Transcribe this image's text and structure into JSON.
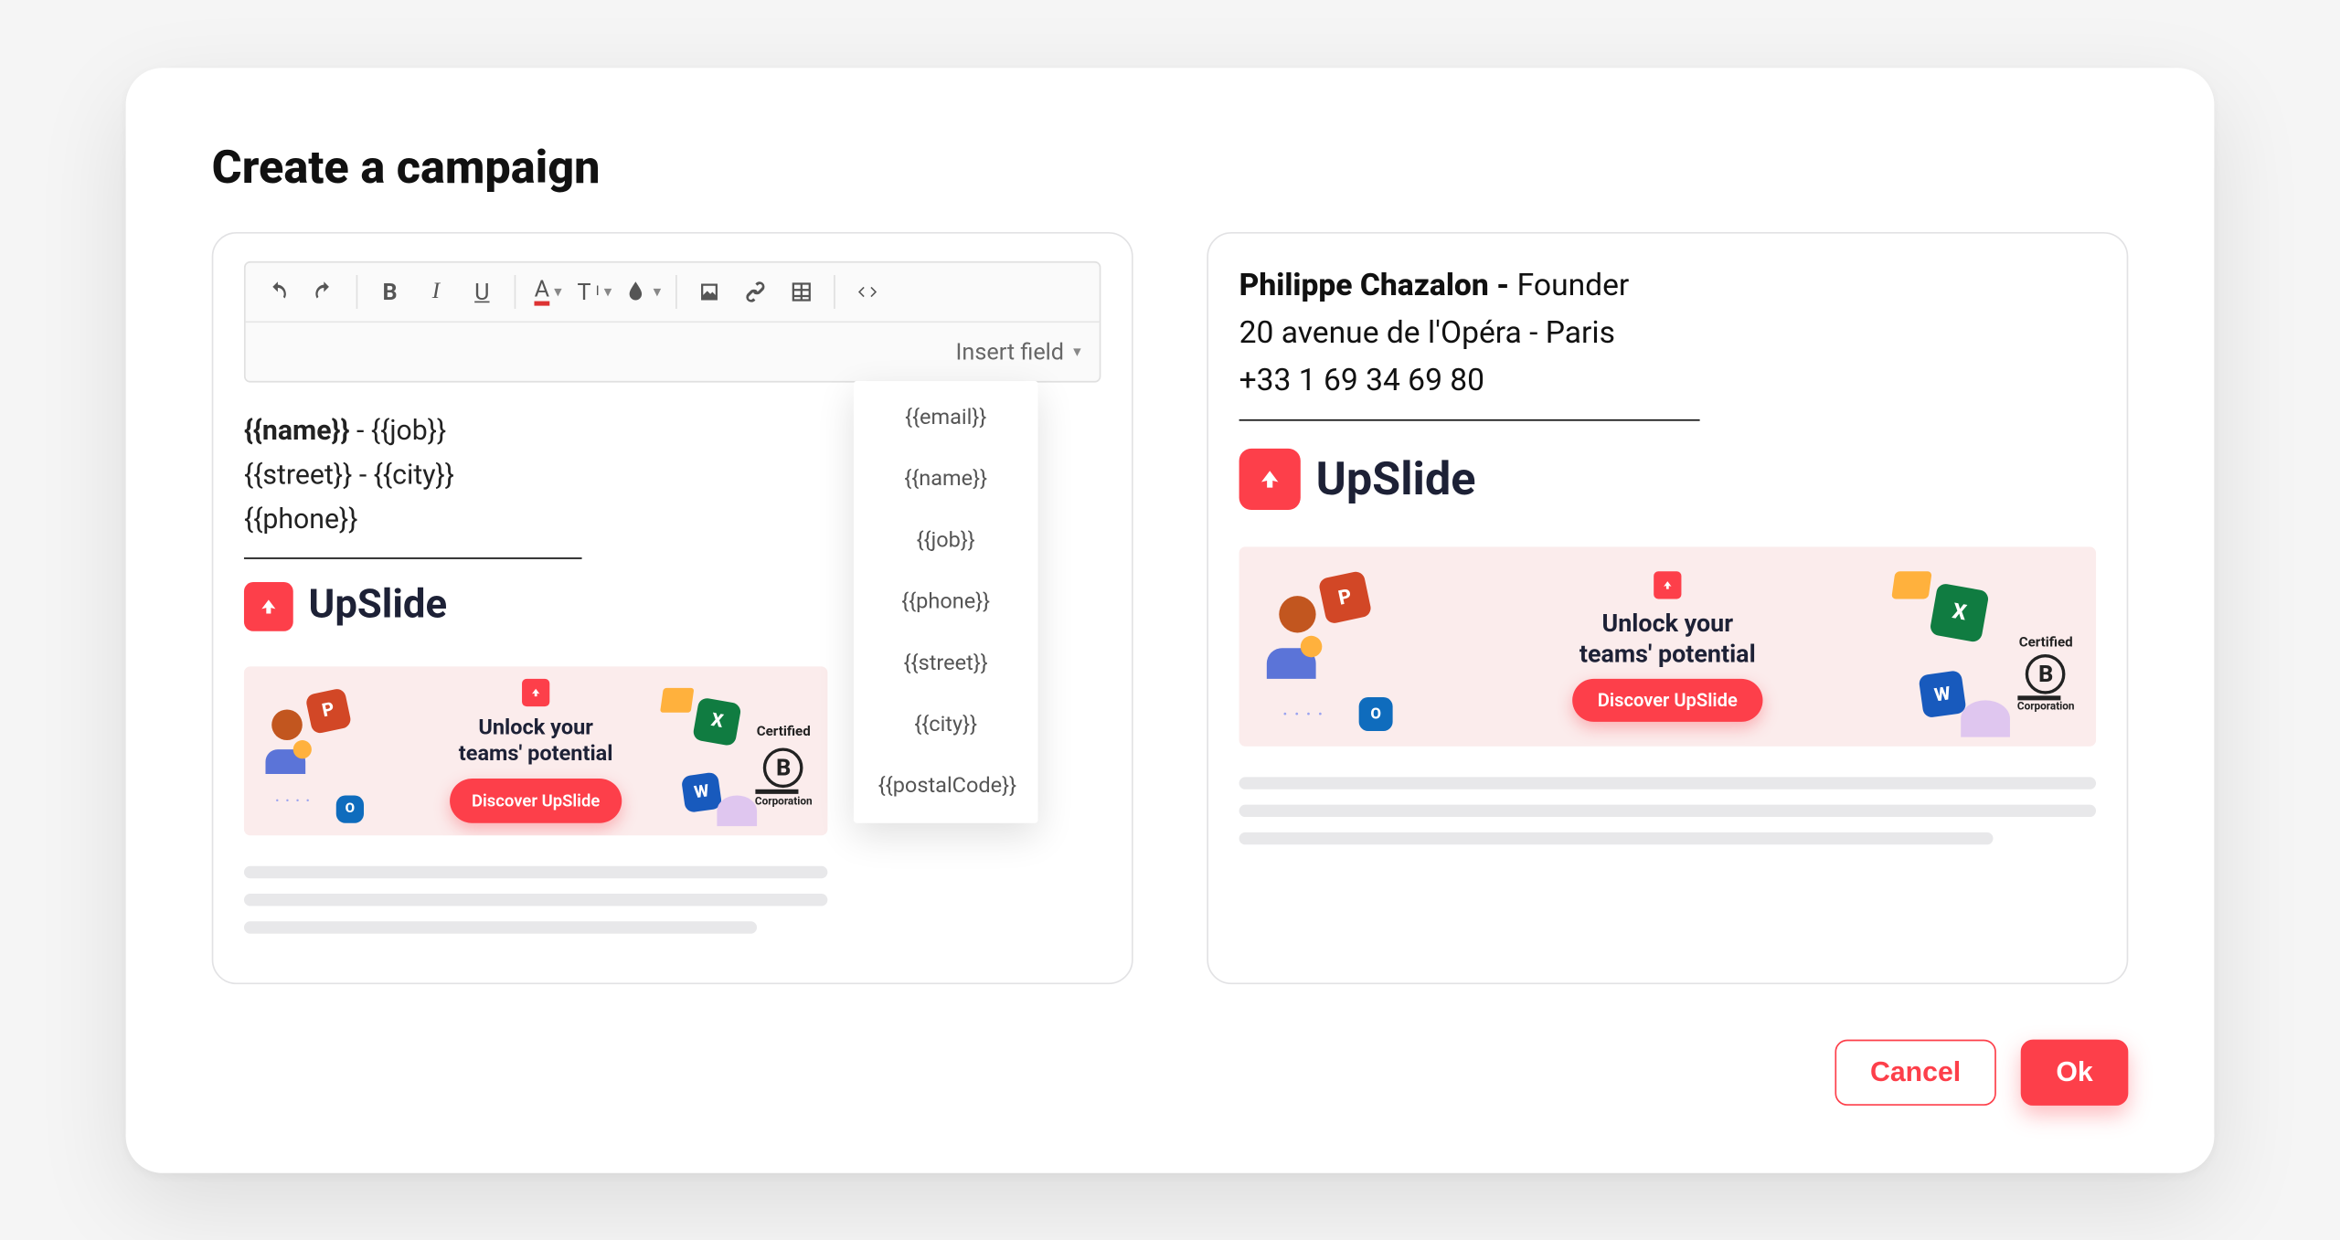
{
  "modal": {
    "title": "Create a campaign"
  },
  "toolbar": {
    "insert_field_label": "Insert field",
    "dropdown_items": [
      "{{email}}",
      "{{name}}",
      "{{job}}",
      "{{phone}}",
      "{{street}}",
      "{{city}}",
      "{{postalCode}}"
    ]
  },
  "editor": {
    "name_token": "{{name}}",
    "sep1": " - ",
    "job_token": "{{job}}",
    "street_token": "{{street}}",
    "sep2": " - ",
    "city_token": "{{city}}",
    "phone_token": "{{phone}}",
    "logo_text": "UpSlide"
  },
  "banner": {
    "title_line1": "Unlock your",
    "title_line2": "teams' potential",
    "cta": "Discover UpSlide",
    "badge_top": "Certified",
    "badge_letter": "B",
    "badge_bottom": "Corporation"
  },
  "preview": {
    "name": "Philippe Chazalon",
    "sep1": " - ",
    "job": "Founder",
    "address": "20 avenue de l'Opéra - Paris",
    "phone": "+33 1 69 34 69 80",
    "logo_text": "UpSlide"
  },
  "buttons": {
    "cancel": "Cancel",
    "ok": "Ok"
  },
  "colors": {
    "accent": "#fd3f4a"
  }
}
